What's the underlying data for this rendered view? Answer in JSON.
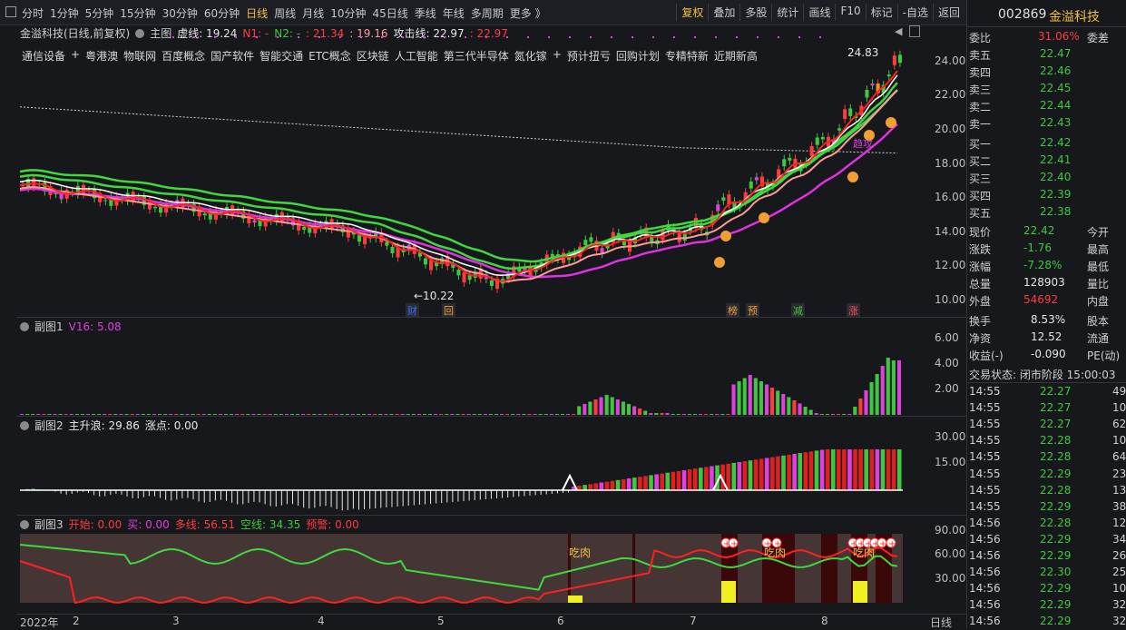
{
  "toolbar": {
    "periods": [
      "分时",
      "1分钟",
      "5分钟",
      "15分钟",
      "30分钟",
      "60分钟",
      "日线",
      "周线",
      "月线",
      "10分钟",
      "45日线",
      "季线",
      "年线",
      "多周期",
      "更多 》"
    ],
    "active_period": "日线",
    "right_buttons": [
      "复权",
      "叠加",
      "多股",
      "统计",
      "画线",
      "F10",
      "标记",
      "-自选",
      "返回"
    ],
    "active_right": "复权"
  },
  "main": {
    "title": "金溢科技(日线,前复权)",
    "indicator_name": "主图",
    "xu_label": "虚线: 19.24",
    "n1_label": "N1: -",
    "n2_label": "N2: -",
    "n2_values": ": 21.34",
    "n2_values2": ": 19.16",
    "attack_label": "攻击线: 22.97",
    "attack_value": ": 22.97",
    "tags": [
      "通信设备",
      "+",
      "粤港澳",
      "物联网",
      "百度概念",
      "国产软件",
      "智能交通",
      "ETC概念",
      "区块链",
      "人工智能",
      "第三代半导体",
      "氮化镓",
      "+",
      "预计扭亏",
      "回购计划",
      "专精特新",
      "近期新高"
    ],
    "high_label": "24.83",
    "low_label": "←10.22",
    "y_ticks": [
      "24.00",
      "22.00",
      "20.00",
      "18.00",
      "16.00",
      "14.00",
      "12.00",
      "10.00"
    ],
    "markers": [
      "财",
      "回",
      "榜",
      "预",
      "减",
      "涨"
    ],
    "trend_label": "趋攻"
  },
  "sub1": {
    "title": "副图1",
    "v16": "V16: 5.08",
    "y_ticks": [
      "6.00",
      "4.00",
      "2.00"
    ]
  },
  "sub2": {
    "title": "副图2",
    "label": "主升浪: 29.86",
    "zd": "涨点: 0.00",
    "y_ticks": [
      "30.00",
      "15.00"
    ],
    "num_marks": [
      "3",
      "3",
      "3",
      "3",
      "3",
      "3"
    ]
  },
  "sub3": {
    "title": "副图3",
    "kaishi": "开始: 0.00",
    "mai": "买: 0.00",
    "duo": "多线: 56.51",
    "kong": "空线: 34.35",
    "yujing": "预警: 0.00",
    "y_ticks": [
      "90.00",
      "60.00",
      "30.00"
    ],
    "chirou": "吃肉"
  },
  "x_axis": {
    "labels": [
      "2022年",
      "2",
      "3",
      "4",
      "5",
      "6",
      "7",
      "8"
    ],
    "period": "日线"
  },
  "quote": {
    "code": "002869",
    "name": "金溢科技",
    "weibi_label": "委比",
    "weibi": "31.06%",
    "weicha_label": "委差",
    "asks": [
      {
        "l": "卖五",
        "p": "22.47"
      },
      {
        "l": "卖四",
        "p": "22.46"
      },
      {
        "l": "卖三",
        "p": "22.45"
      },
      {
        "l": "卖二",
        "p": "22.44"
      },
      {
        "l": "卖一",
        "p": "22.43"
      }
    ],
    "bids": [
      {
        "l": "买一",
        "p": "22.42"
      },
      {
        "l": "买二",
        "p": "22.41"
      },
      {
        "l": "买三",
        "p": "22.40"
      },
      {
        "l": "买四",
        "p": "22.39"
      },
      {
        "l": "买五",
        "p": "22.38"
      }
    ],
    "stats": [
      {
        "l": "现价",
        "v": "22.42",
        "l2": "今开",
        "c": "green"
      },
      {
        "l": "涨跌",
        "v": "-1.76",
        "l2": "最高",
        "c": "green"
      },
      {
        "l": "涨幅",
        "v": "-7.28%",
        "l2": "最低",
        "c": "green"
      },
      {
        "l": "总量",
        "v": "128903",
        "l2": "量比",
        "c": "white"
      },
      {
        "l": "外盘",
        "v": "54692",
        "l2": "内盘",
        "c": "red"
      }
    ],
    "stats2": [
      {
        "l": "换手",
        "v": "8.53%",
        "l2": "股本"
      },
      {
        "l": "净资",
        "v": "12.52",
        "l2": "流通"
      },
      {
        "l": "收益(-)",
        "v": "-0.090",
        "l2": "PE(动)"
      }
    ],
    "trade_status": "交易状态: 闭市阶段 15:00:03",
    "ticks": [
      {
        "t": "14:55",
        "p": "22.27",
        "v": "49",
        "c": "green"
      },
      {
        "t": "14:55",
        "p": "22.27",
        "v": "10",
        "c": "green"
      },
      {
        "t": "14:55",
        "p": "22.27",
        "v": "62",
        "c": "green"
      },
      {
        "t": "14:55",
        "p": "22.28",
        "v": "103",
        "c": "green"
      },
      {
        "t": "14:55",
        "p": "22.28",
        "v": "64",
        "c": "green"
      },
      {
        "t": "14:55",
        "p": "22.29",
        "v": "23",
        "c": "green"
      },
      {
        "t": "14:55",
        "p": "22.28",
        "v": "13",
        "c": "green"
      },
      {
        "t": "14:55",
        "p": "22.29",
        "v": "38",
        "c": "green"
      },
      {
        "t": "14:56",
        "p": "22.28",
        "v": "125",
        "c": "green"
      },
      {
        "t": "14:56",
        "p": "22.29",
        "v": "34",
        "c": "green"
      },
      {
        "t": "14:56",
        "p": "22.29",
        "v": "26",
        "c": "green"
      },
      {
        "t": "14:56",
        "p": "22.30",
        "v": "259",
        "c": "green"
      },
      {
        "t": "14:56",
        "p": "22.29",
        "v": "104",
        "c": "green"
      },
      {
        "t": "14:56",
        "p": "22.29",
        "v": "32",
        "c": "green"
      },
      {
        "t": "14:56",
        "p": "22.29",
        "v": "32",
        "c": "green"
      }
    ]
  }
}
